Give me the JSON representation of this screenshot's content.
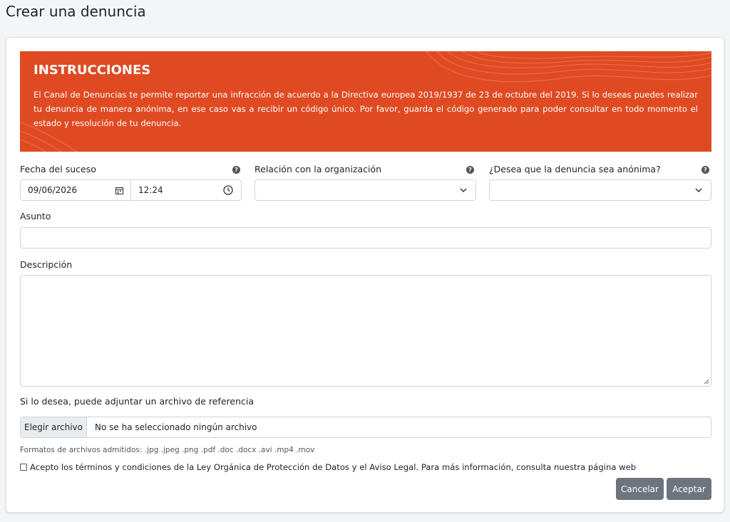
{
  "page": {
    "title": "Crear una denuncia"
  },
  "instructions": {
    "title": "INSTRUCCIONES",
    "body": "El Canal de Denuncias te permite reportar una infracción de acuerdo a la Directiva europea 2019/1937 de 23 de octubre del 2019. Si lo deseas puedes realizar tu denuncia de manera anónima, en ese caso vas a recibir un código único. Por favor, guarda el código generado para poder consultar en todo momento el estado y resolución de tu denuncia.",
    "background_color": "#e04a22"
  },
  "form": {
    "fecha": {
      "label": "Fecha del suceso",
      "date_value": "09/06/2026",
      "time_value": "12:24"
    },
    "relacion": {
      "label": "Relación con la organización",
      "value": ""
    },
    "anonima": {
      "label": "¿Desea que la denuncia sea anónima?",
      "value": ""
    },
    "asunto": {
      "label": "Asunto",
      "value": ""
    },
    "descripcion": {
      "label": "Descripción",
      "value": ""
    },
    "adjunto": {
      "label": "Si lo desea, puede adjuntar un archivo de referencia",
      "button_label": "Elegir archivo",
      "file_status": "No se ha seleccionado ningún archivo",
      "formats_hint": "Formatos de archivos admitidos: .jpg .jpeg .png .pdf .doc .docx .avi .mp4 .mov"
    },
    "terms": {
      "label": "Acepto los términos y condiciones de la Ley Orgánica de Protección de Datos y el Aviso Legal. Para más información, consulta nuestra página web",
      "checked": false
    }
  },
  "actions": {
    "cancel_label": "Cancelar",
    "accept_label": "Aceptar",
    "button_color": "#6c757d"
  },
  "help_icon": "?"
}
